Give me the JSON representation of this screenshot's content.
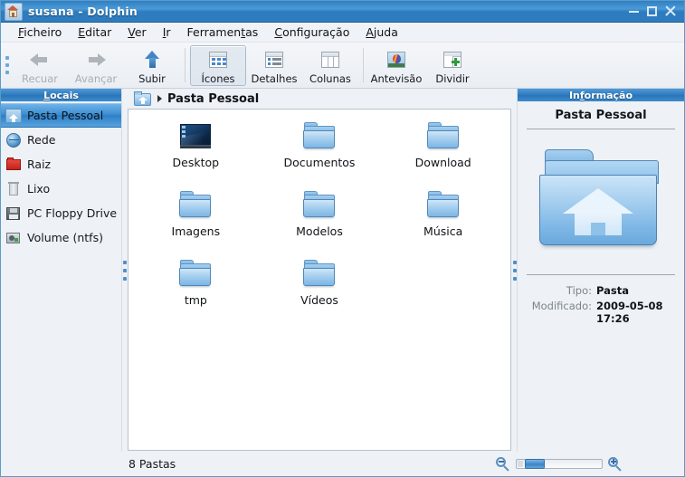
{
  "window": {
    "title": "susana - Dolphin",
    "icon": "home-house-icon",
    "controls": {
      "minimize": "−",
      "maximize": "□",
      "close": "✕"
    }
  },
  "menubar": {
    "items": [
      {
        "label": "Ficheiro",
        "accel": "F"
      },
      {
        "label": "Editar",
        "accel": "E"
      },
      {
        "label": "Ver",
        "accel": "V"
      },
      {
        "label": "Ir",
        "accel": "I"
      },
      {
        "label": "Ferramentas",
        "accel": "t"
      },
      {
        "label": "Configuração",
        "accel": "C"
      },
      {
        "label": "Ajuda",
        "accel": "A"
      }
    ]
  },
  "toolbar": {
    "buttons": [
      {
        "label": "Recuar",
        "icon": "arrow-left-icon",
        "enabled": false,
        "selected": false
      },
      {
        "label": "Avançar",
        "icon": "arrow-right-icon",
        "enabled": false,
        "selected": false
      },
      {
        "label": "Subir",
        "icon": "arrow-up-icon",
        "enabled": true,
        "selected": false
      },
      {
        "label": "Ícones",
        "icon": "view-icons-icon",
        "enabled": true,
        "selected": true
      },
      {
        "label": "Detalhes",
        "icon": "view-details-icon",
        "enabled": true,
        "selected": false
      },
      {
        "label": "Colunas",
        "icon": "view-columns-icon",
        "enabled": true,
        "selected": false
      },
      {
        "label": "Antevisão",
        "icon": "preview-image-icon",
        "enabled": true,
        "selected": false
      },
      {
        "label": "Dividir",
        "icon": "split-view-icon",
        "enabled": true,
        "selected": false
      }
    ]
  },
  "places": {
    "header": "Locais",
    "header_accel": "L",
    "items": [
      {
        "label": "Pasta Pessoal",
        "icon": "home-folder-icon",
        "selected": true
      },
      {
        "label": "Rede",
        "icon": "network-globe-icon",
        "selected": false
      },
      {
        "label": "Raiz",
        "icon": "root-folder-icon",
        "selected": false
      },
      {
        "label": "Lixo",
        "icon": "trash-icon",
        "selected": false
      },
      {
        "label": "PC Floppy Drive",
        "icon": "floppy-drive-icon",
        "selected": false
      },
      {
        "label": "Volume (ntfs)",
        "icon": "hard-drive-icon",
        "selected": false
      }
    ]
  },
  "breadcrumb": {
    "icon": "home-folder-icon",
    "separator": "▸",
    "path": "Pasta Pessoal"
  },
  "files": [
    {
      "name": "Desktop",
      "type": "desktop"
    },
    {
      "name": "Documentos",
      "type": "folder"
    },
    {
      "name": "Download",
      "type": "folder"
    },
    {
      "name": "Imagens",
      "type": "folder"
    },
    {
      "name": "Modelos",
      "type": "folder"
    },
    {
      "name": "Música",
      "type": "folder"
    },
    {
      "name": "tmp",
      "type": "folder"
    },
    {
      "name": "Vídeos",
      "type": "folder"
    }
  ],
  "info": {
    "header": "Informação",
    "header_accel": "f",
    "title": "Pasta Pessoal",
    "icon": "home-folder-large-icon",
    "props": [
      {
        "key": "Tipo:",
        "value": "Pasta"
      },
      {
        "key": "Modificado:",
        "value": "2009-05-08 17:26"
      }
    ]
  },
  "statusbar": {
    "text": "8 Pastas",
    "zoom_out_icon": "zoom-out-icon",
    "zoom_in_icon": "zoom-in-icon",
    "slider_value": 20
  },
  "colors": {
    "titlebar": "#2f7cc0",
    "panel_header": "#2f7cc0",
    "selection": "#3d8fd3",
    "window_bg": "#eef1f5",
    "view_bg": "#ffffff"
  }
}
